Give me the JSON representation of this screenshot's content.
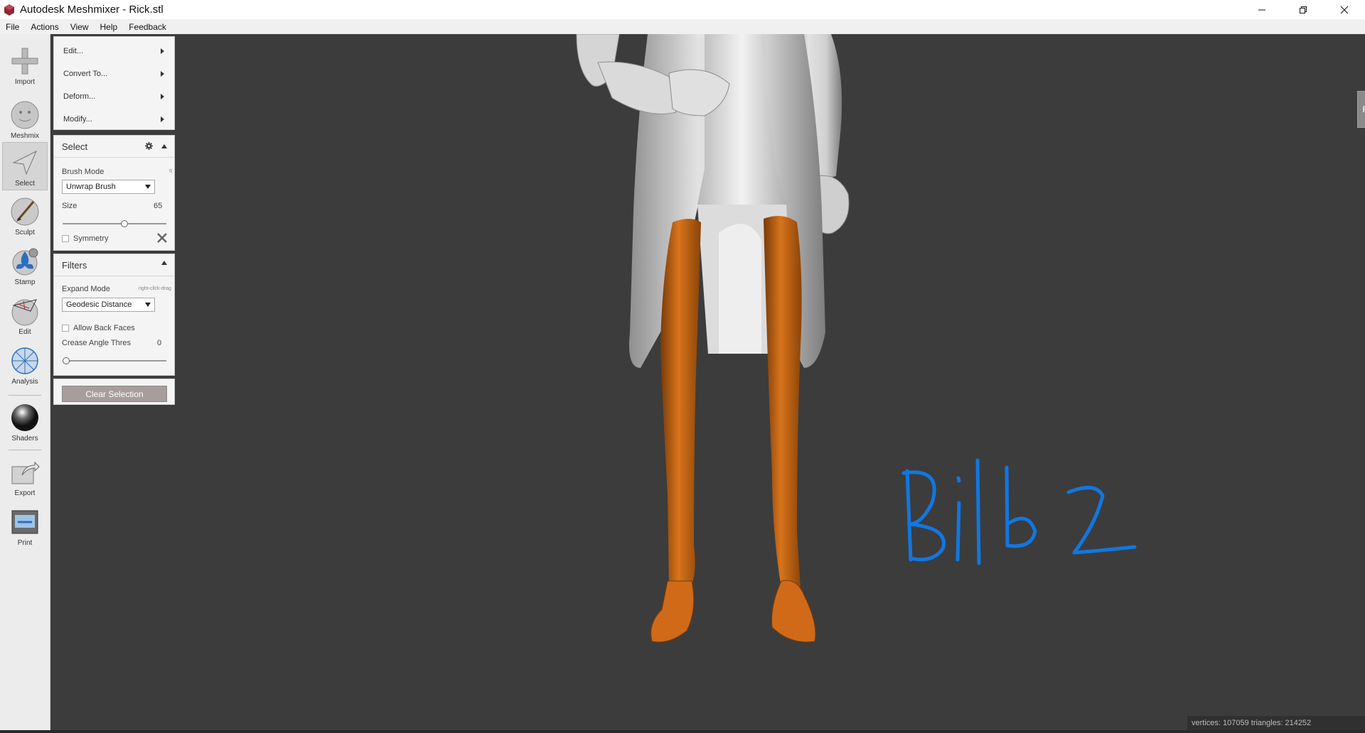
{
  "window": {
    "title": "Autodesk Meshmixer - Rick.stl",
    "controls": [
      "minimize",
      "restore",
      "close"
    ]
  },
  "menubar": {
    "items": [
      "File",
      "Actions",
      "View",
      "Help",
      "Feedback"
    ]
  },
  "toolbar": {
    "tools": [
      {
        "label": "Import",
        "icon": "plus-icon"
      },
      {
        "label": "Meshmix",
        "icon": "meshmix-head-icon"
      },
      {
        "label": "Select",
        "icon": "select-arrow-icon",
        "active": true
      },
      {
        "label": "Sculpt",
        "icon": "brush-icon"
      },
      {
        "label": "Stamp",
        "icon": "stamp-icon"
      },
      {
        "label": "Edit",
        "icon": "edit-sphere-icon"
      },
      {
        "label": "Analysis",
        "icon": "analysis-sphere-icon"
      },
      {
        "label": "Shaders",
        "icon": "shader-sphere-icon"
      },
      {
        "label": "Export",
        "icon": "export-icon"
      },
      {
        "label": "Print",
        "icon": "printer-icon"
      }
    ]
  },
  "edit_panel": {
    "items": [
      "Edit...",
      "Convert To...",
      "Deform...",
      "Modify..."
    ]
  },
  "select_panel": {
    "title": "Select",
    "brush_mode_label": "Brush Mode",
    "brush_mode_hint": "q",
    "brush_mode_value": "Unwrap Brush",
    "size_label": "Size",
    "size_value": "65",
    "size_fraction": 0.6,
    "symmetry_label": "Symmetry",
    "symmetry_checked": false
  },
  "filters_panel": {
    "title": "Filters",
    "expand_mode_label": "Expand Mode",
    "expand_mode_hint": "right-click-drag",
    "expand_mode_value": "Geodesic Distance",
    "allow_back_faces_label": "Allow Back Faces",
    "allow_back_faces_checked": false,
    "crease_label": "Crease Angle Thres",
    "crease_value": "0",
    "crease_fraction": 0.0
  },
  "clear_selection_label": "Clear Selection",
  "viewport": {
    "viewcube_label": "RIGHT",
    "annotation_text": "Bild 2",
    "annotation_color": "#1177e0",
    "selection_color": "#c86414",
    "model_color": "#c8c8c8"
  },
  "status": {
    "text": "vertices: 107059 triangles: 214252"
  }
}
